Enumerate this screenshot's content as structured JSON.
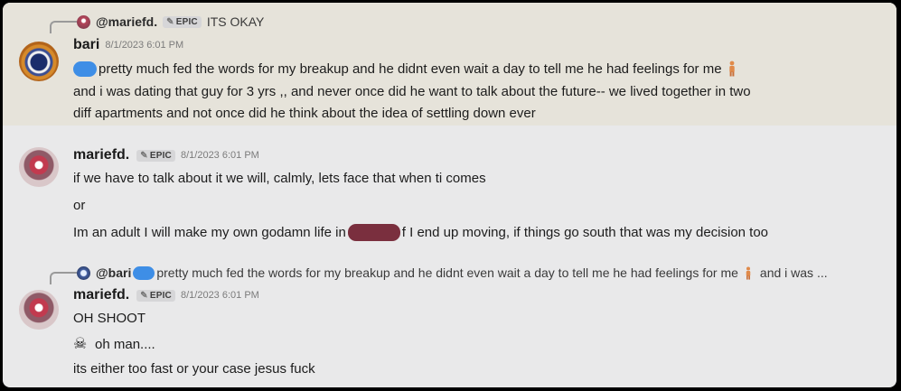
{
  "messages": {
    "bari_msg": {
      "reply": {
        "username": "@mariefd.",
        "badge": "EPIC",
        "text": "ITS OKAY"
      },
      "author": "bari",
      "timestamp": "8/1/2023 6:01 PM",
      "lines": [
        "pretty much fed the words for my breakup and he didnt even wait a day to tell me he had feelings for me",
        "and i was dating that guy for 3 yrs ,, and never once did he want to talk about the future-- we lived together in two",
        "diff apartments and not once did he think about the idea of settling down ever"
      ]
    },
    "marie_msg1": {
      "author": "mariefd.",
      "badge": "EPIC",
      "timestamp": "8/1/2023 6:01 PM",
      "lines": [
        "if we have to talk about it we will, calmly, lets face that when ti comes",
        "or",
        "Im an adult I will make my own godamn life in",
        "f I end up moving, if things go south that was my decision too"
      ]
    },
    "marie_msg2": {
      "reply": {
        "username": "@bari",
        "text": "pretty much fed the words for my breakup and he didnt even wait a day to tell me he had feelings for me",
        "suffix": "and i was ..."
      },
      "author": "mariefd.",
      "badge": "EPIC",
      "timestamp": "8/1/2023 6:01 PM",
      "lines": [
        "OH SHOOT",
        "oh man....",
        "its either too fast or your case jesus fuck"
      ]
    }
  },
  "colors": {
    "highlight_bg": "#e6e3da",
    "chat_bg": "#e9e9ea",
    "redact_blue": "#3e8ee6",
    "redact_red": "#7a2f3e"
  }
}
